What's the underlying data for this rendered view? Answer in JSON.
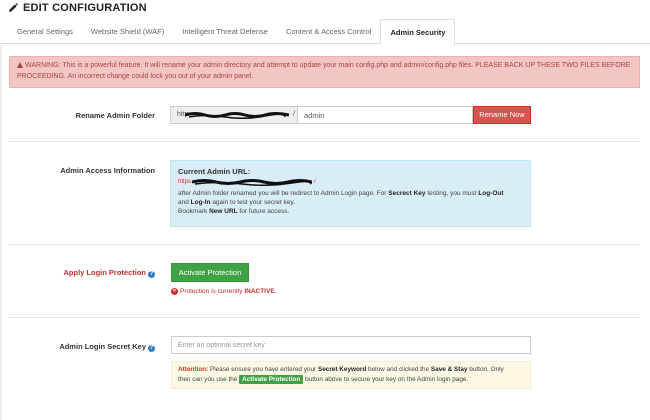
{
  "header": {
    "title": "EDIT CONFIGURATION",
    "icon": "pencil-icon"
  },
  "tabs": [
    {
      "label": "General Settings",
      "active": false
    },
    {
      "label": "Website Shield (WAF)",
      "active": false
    },
    {
      "label": "Intelligent Threat Defense",
      "active": false
    },
    {
      "label": "Content & Access Control",
      "active": false
    },
    {
      "label": "Admin Security",
      "active": true
    }
  ],
  "warning": {
    "text": "WARNING: This is a powerful feature. It will rename your admin directory and attempt to update your main config.php and admin/config.php files. PLEASE BACK UP THESE TWO FILES BEFORE PROCEEDING. An incorrect change could lock you out of your admin panel."
  },
  "rename": {
    "label": "Rename Admin Folder",
    "prefix": "http",
    "prefix_end": "/",
    "value": "admin",
    "button": "Rename Now"
  },
  "access_info": {
    "label": "Admin Access Information",
    "title": "Current Admin URL:",
    "url_start": "https",
    "url_end": "/",
    "line1_a": "after Admin folder renamed you will be redirect to Admin Login page. For ",
    "line1_b": "Secrect Key",
    "line1_c": " testing, you must ",
    "line1_d": "Log-Out",
    "line2_a": "and ",
    "line2_b": "Log-In",
    "line2_c": " again to test your secret key.",
    "line3_a": "Bookmark ",
    "line3_b": "New URL",
    "line3_c": " for future access."
  },
  "login_protection": {
    "label": "Apply Login Protection",
    "button": "Activate Protection",
    "status_a": "Protection is currently ",
    "status_b": "INACTIVE",
    "status_c": "."
  },
  "secret_key": {
    "label": "Admin Login Secret Key",
    "placeholder": "Enter an optional secret key",
    "attention_label": "Attention:",
    "att_a": " Please ensure you have entered your ",
    "att_b": "Secret Keyword",
    "att_c": " below and clicked the ",
    "att_d": "Save & Stay",
    "att_e": " button. Only",
    "att_f": "then can you use the ",
    "att_btn": "Activate Protection",
    "att_g": " button above to secure your key on the Admin login page."
  },
  "colors": {
    "danger": "#d9534f",
    "success": "#3fa346",
    "info_bg": "#d9edf7",
    "warning_bg": "#f2c7c3",
    "attention_bg": "#fcf8e3",
    "help_icon": "#2f7fc1"
  }
}
